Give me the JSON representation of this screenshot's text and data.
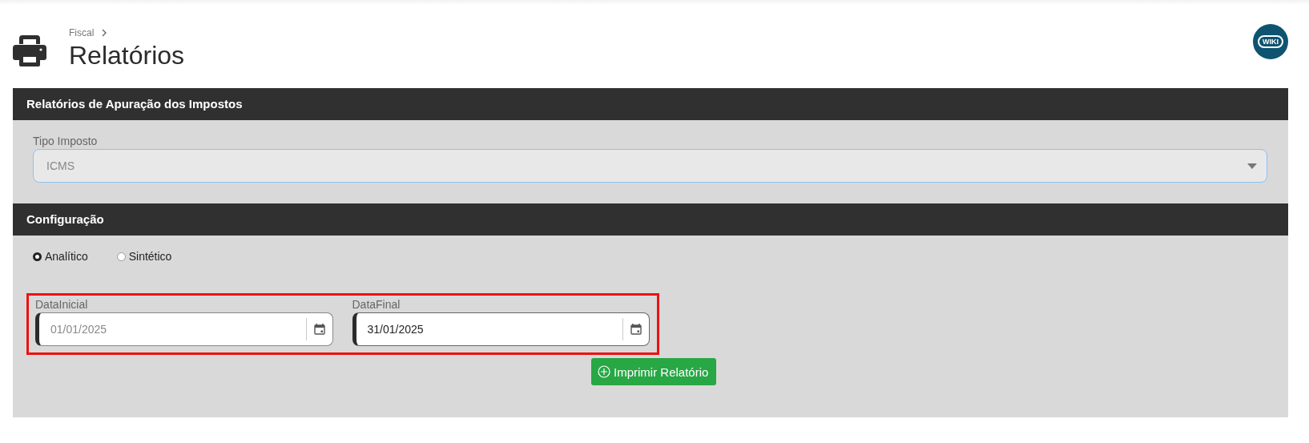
{
  "breadcrumb": [
    "Fiscal"
  ],
  "page_title": "Relatórios",
  "wiki_button": "WIKI",
  "tax_section": {
    "title": "Relatórios de Apuração dos Impostos",
    "field": {
      "label": "Tipo Imposto",
      "value": "ICMS",
      "disabled": true
    }
  },
  "config_section": {
    "title": "Configuração",
    "radios": [
      {
        "label": "Analítico",
        "selected": true
      },
      {
        "label": "Sintético",
        "selected": false
      }
    ],
    "dates_highlighted": true,
    "dates": [
      {
        "label": "DataInicial",
        "value": "01/01/2025",
        "disabled": true
      },
      {
        "label": "DataFinal",
        "value": "31/01/2025",
        "disabled": false
      }
    ],
    "print_button": "Imprimir Relatório"
  }
}
